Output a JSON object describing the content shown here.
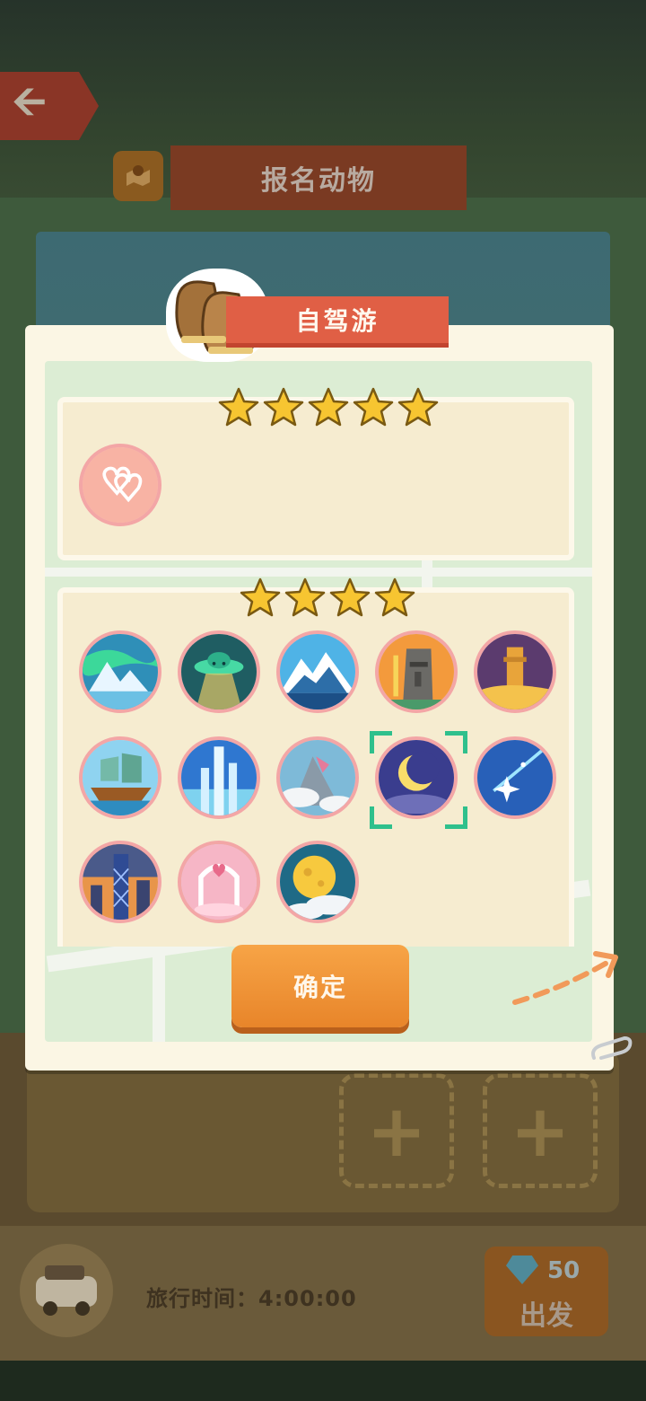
{
  "header": {
    "back_icon": "arrow-left-icon",
    "map_icon": "map-pin-icon",
    "title": "报名动物"
  },
  "modal": {
    "title": "自驾游",
    "title_icon": "boots-icon",
    "top_section": {
      "star_count": 5,
      "items": [
        {
          "icon": "double-heart-icon"
        }
      ]
    },
    "bottom_section": {
      "star_count": 4,
      "items": [
        {
          "icon": "iceberg-aurora-icon"
        },
        {
          "icon": "ufo-icon"
        },
        {
          "icon": "snow-mountain-icon"
        },
        {
          "icon": "moai-statue-icon"
        },
        {
          "icon": "desert-tower-icon"
        },
        {
          "icon": "sailing-ship-icon"
        },
        {
          "icon": "skyscraper-icon"
        },
        {
          "icon": "cloud-mountain-icon"
        },
        {
          "icon": "crescent-moon-icon",
          "selected": true
        },
        {
          "icon": "shooting-star-icon"
        },
        {
          "icon": "city-tower-icon"
        },
        {
          "icon": "heart-gate-icon"
        },
        {
          "icon": "full-moon-icon"
        }
      ]
    },
    "confirm_label": "确定"
  },
  "footer": {
    "vehicle_icon": "car-icon",
    "travel_time": "旅行时间：4:00:00",
    "depart": {
      "cost": "50",
      "cost_icon": "gem-icon",
      "label": "出发"
    }
  },
  "colors": {
    "ribbon": "#e05f45",
    "confirm": "#e8852a",
    "icon_border": "#f3a6a6",
    "selection": "#2fc08c",
    "star": "#f7c531"
  }
}
